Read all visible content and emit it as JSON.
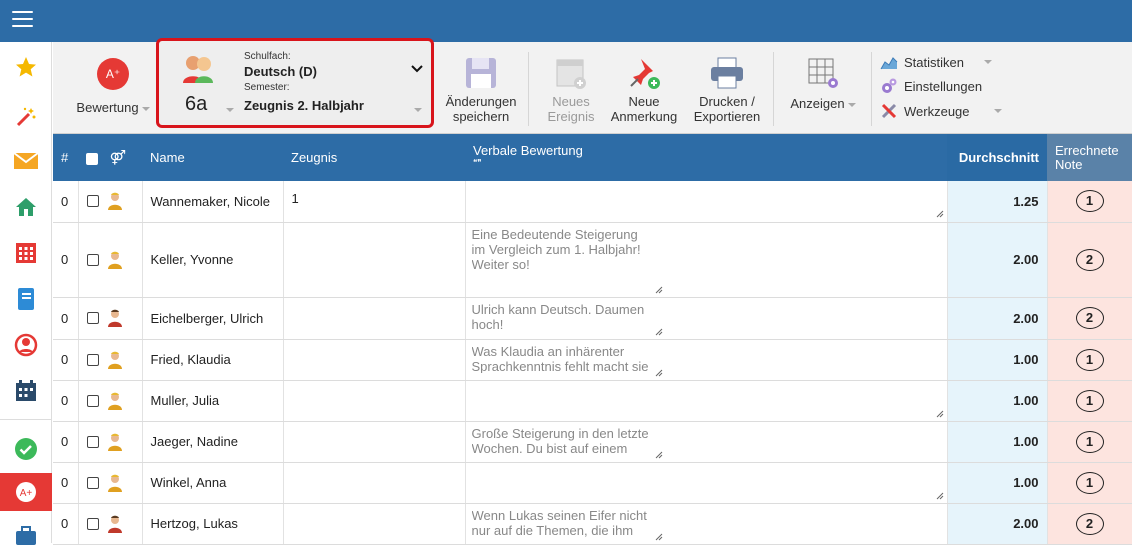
{
  "toolbar": {
    "bewertung_label": "Bewertung",
    "schulfach_label": "Schulfach:",
    "schulfach_value": "Deutsch (D)",
    "semester_label": "Semester:",
    "semester_value": "Zeugnis 2. Halbjahr",
    "class_value": "6a",
    "save_line1": "Änderungen",
    "save_line2": "speichern",
    "new_event_line1": "Neues",
    "new_event_line2": "Ereignis",
    "new_note_line1": "Neue",
    "new_note_line2": "Anmerkung",
    "print_line1": "Drucken /",
    "print_line2": "Exportieren",
    "view_label": "Anzeigen",
    "stats_label": "Statistiken",
    "settings_label": "Einstellungen",
    "tools_label": "Werkzeuge"
  },
  "table": {
    "headers": {
      "num": "#",
      "name": "Name",
      "zeugnis": "Zeugnis",
      "verbal": "Verbale Bewertung",
      "verbal_sub": "❝❞",
      "avg": "Durchschnitt",
      "note_line1": "Errechnete",
      "note_line2": "Note"
    },
    "rows": [
      {
        "num": "0",
        "name": "Wannemaker, Nicole",
        "gender": "f",
        "zeugnis": "1",
        "verbal": "",
        "avg": "1.25",
        "grade": "1"
      },
      {
        "num": "0",
        "name": "Keller, Yvonne",
        "gender": "f",
        "zeugnis": "",
        "verbal": "Eine Bedeutende Steigerung im Vergleich zum 1. Halbjahr! Weiter so!",
        "avg": "2.00",
        "grade": "2"
      },
      {
        "num": "0",
        "name": "Eichelberger, Ulrich",
        "gender": "m",
        "zeugnis": "",
        "verbal": "Ulrich kann Deutsch. Daumen hoch!",
        "avg": "2.00",
        "grade": "2"
      },
      {
        "num": "0",
        "name": "Fried, Klaudia",
        "gender": "f",
        "zeugnis": "",
        "verbal": "Was Klaudia an inhärenter Sprachkenntnis fehlt macht sie durch Fleiß wett. Weiter",
        "avg": "1.00",
        "grade": "1"
      },
      {
        "num": "0",
        "name": "Muller, Julia",
        "gender": "f",
        "zeugnis": "",
        "verbal": "",
        "avg": "1.00",
        "grade": "1"
      },
      {
        "num": "0",
        "name": "Jaeger, Nadine",
        "gender": "f",
        "zeugnis": "",
        "verbal": "Große Steigerung in den letzte Wochen. Du bist auf einem guten Weg, Nadine!",
        "avg": "1.00",
        "grade": "1"
      },
      {
        "num": "0",
        "name": "Winkel, Anna",
        "gender": "f",
        "zeugnis": "",
        "verbal": "",
        "avg": "1.00",
        "grade": "1"
      },
      {
        "num": "0",
        "name": "Hertzog, Lukas",
        "gender": "m",
        "zeugnis": "",
        "verbal": "Wenn Lukas seinen Eifer nicht nur auf die Themen, die ihm Spaß machen",
        "avg": "2.00",
        "grade": "2"
      }
    ]
  },
  "colors": {
    "header_blue": "#2d6ca6",
    "avg_bg": "#e6f4fb",
    "note_bg": "#fde4df",
    "highlight_red": "#d8141b"
  }
}
